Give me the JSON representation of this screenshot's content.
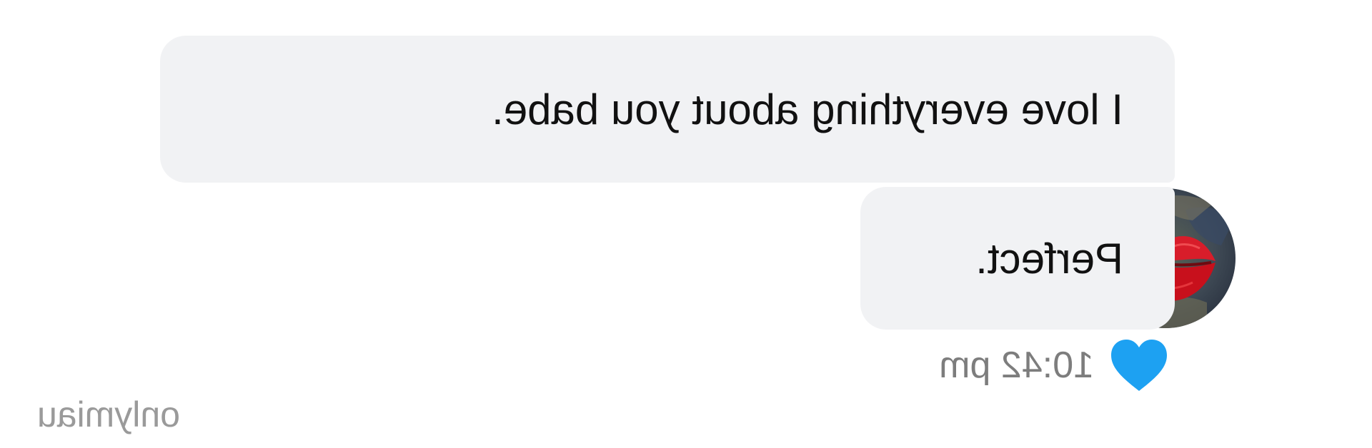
{
  "conversation": {
    "messages": [
      {
        "text": "I love everything about you babe."
      },
      {
        "text": "Perfect."
      }
    ],
    "timestamp": "10:42 pm",
    "reaction_icon": "heart-icon",
    "reaction_color": "#1da1f2",
    "bubble_color": "#f1f2f4"
  },
  "avatar": {
    "icon": "lips-kiss-icon"
  },
  "watermark": {
    "text": "onlymiau"
  }
}
